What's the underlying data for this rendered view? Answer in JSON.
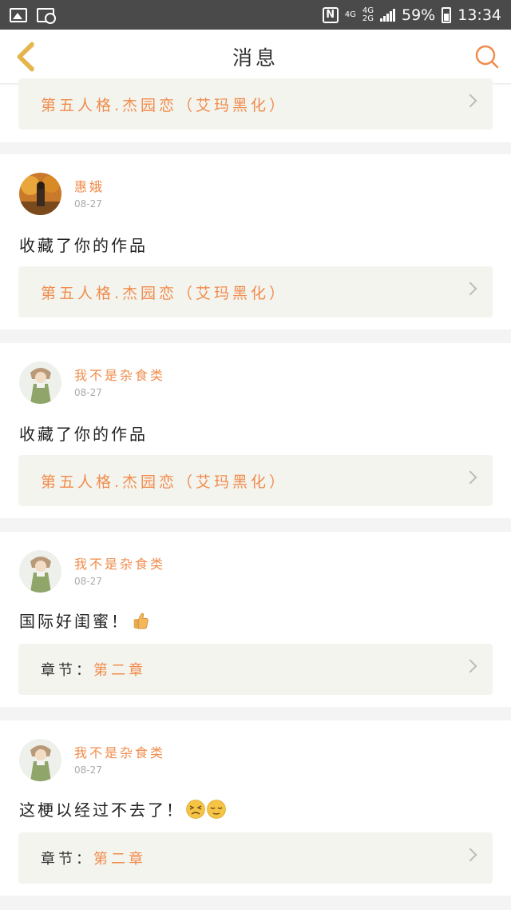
{
  "status_bar": {
    "net_top": "4G",
    "net_bottom": "4G",
    "net_bottom2": "2G",
    "battery": "59%",
    "time": "13:34",
    "nfc": "N"
  },
  "header": {
    "title": "消息"
  },
  "work_title": "第五人格.杰园恋（艾玛黑化）",
  "notifications": [
    {
      "user": "惠娥",
      "date": "08-27",
      "message": "收藏了你的作品",
      "work": "第五人格.杰园恋（艾玛黑化）"
    },
    {
      "user": "我不是杂食类",
      "date": "08-27",
      "message": "收藏了你的作品",
      "work": "第五人格.杰园恋（艾玛黑化）"
    },
    {
      "user": "我不是杂食类",
      "date": "08-27",
      "message": "国际好闺蜜！",
      "chapter_label": "章节：",
      "chapter": "第二章"
    },
    {
      "user": "我不是杂食类",
      "date": "08-27",
      "message": "这梗以经过不去了！",
      "chapter_label": "章节：",
      "chapter": "第二章"
    }
  ],
  "colors": {
    "accent": "#f08c4c",
    "box": "#f4f4ef"
  },
  "icons": [
    "back-arrow-icon",
    "search-icon",
    "thumbs-up-emoji",
    "dizzy-face-emoji",
    "relieved-face-emoji"
  ]
}
